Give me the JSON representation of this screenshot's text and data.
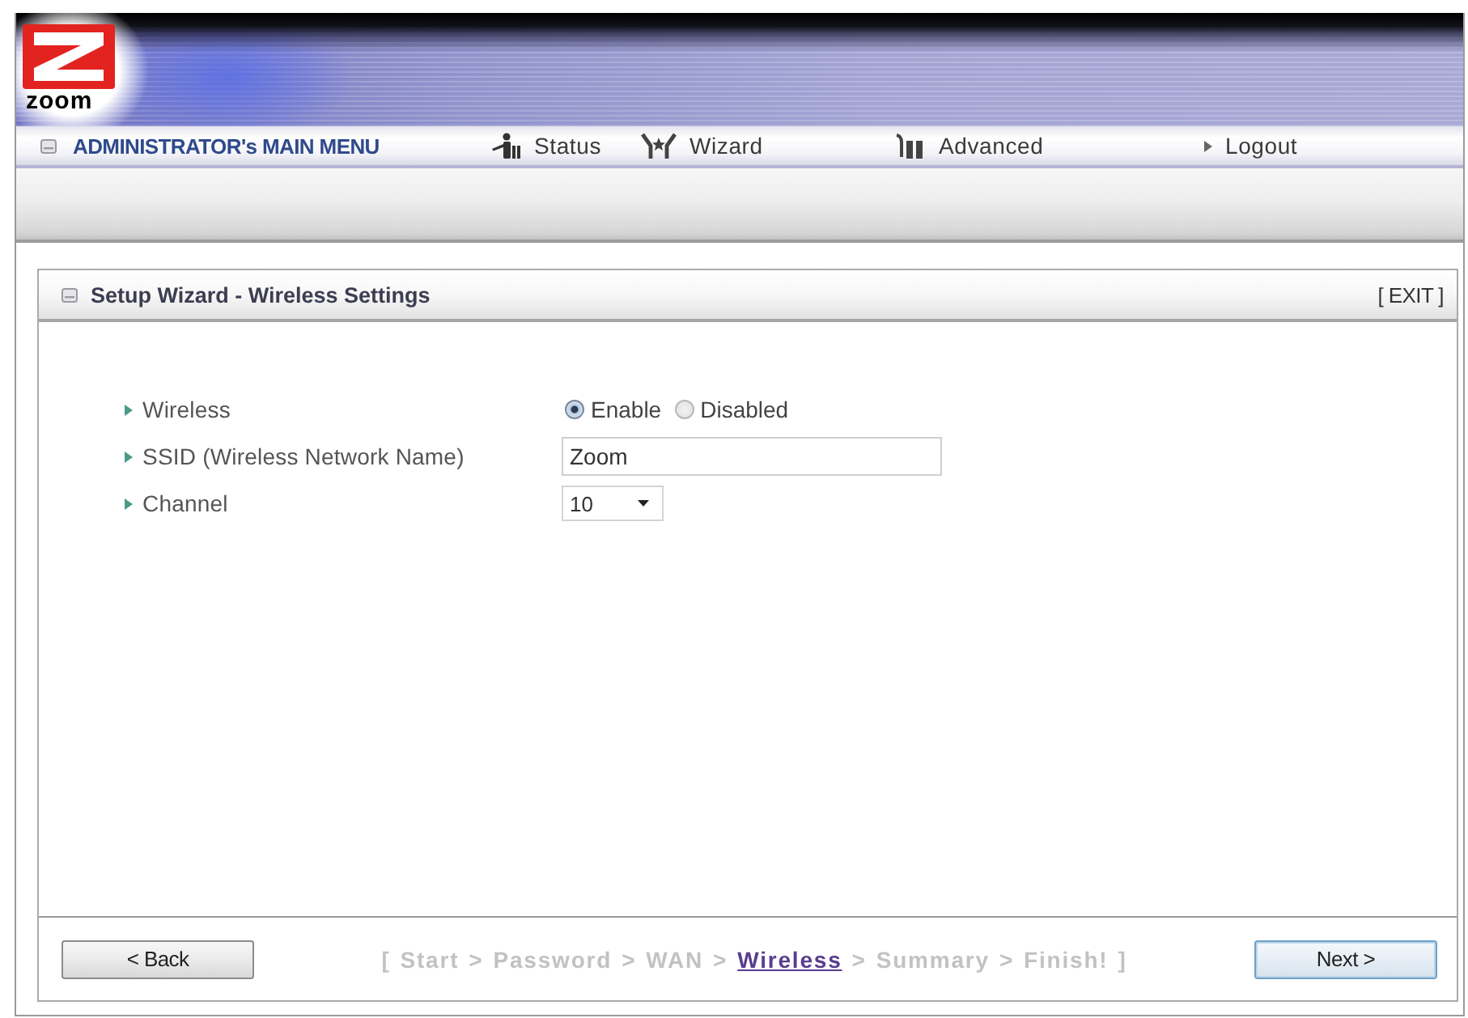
{
  "header": {
    "logo_text": "zoom"
  },
  "nav": {
    "title": "ADMINISTRATOR's MAIN MENU",
    "items": [
      {
        "kind": "status",
        "label": "Status"
      },
      {
        "kind": "wizard",
        "label": "Wizard"
      },
      {
        "kind": "advanced",
        "label": "Advanced"
      },
      {
        "kind": "logout",
        "label": "Logout"
      }
    ]
  },
  "panel": {
    "title": "Setup Wizard - Wireless Settings",
    "exit": "[ EXIT ]"
  },
  "form": {
    "rows": [
      {
        "kind": "radio",
        "label": "Wireless",
        "options": [
          {
            "label": "Enable",
            "selected": true
          },
          {
            "label": "Disabled",
            "selected": false
          }
        ]
      },
      {
        "kind": "text",
        "label": "SSID (Wireless Network Name)",
        "value": "Zoom"
      },
      {
        "kind": "select",
        "label": "Channel",
        "value": "10"
      }
    ]
  },
  "footer": {
    "back_button": {
      "label": "< Back",
      "focused": false
    },
    "next_button": {
      "label": "Next >",
      "focused": true
    },
    "steps": {
      "open": "[",
      "close": "]",
      "items": [
        {
          "label": "Start",
          "selected": false,
          "separator": ">"
        },
        {
          "label": "Password",
          "selected": false,
          "separator": ">"
        },
        {
          "label": "WAN",
          "selected": false,
          "separator": ">"
        },
        {
          "label": "Wireless",
          "selected": true,
          "separator": ">"
        },
        {
          "label": "Summary",
          "selected": false,
          "separator": ">"
        },
        {
          "label": "Finish!",
          "selected": false
        }
      ]
    }
  }
}
